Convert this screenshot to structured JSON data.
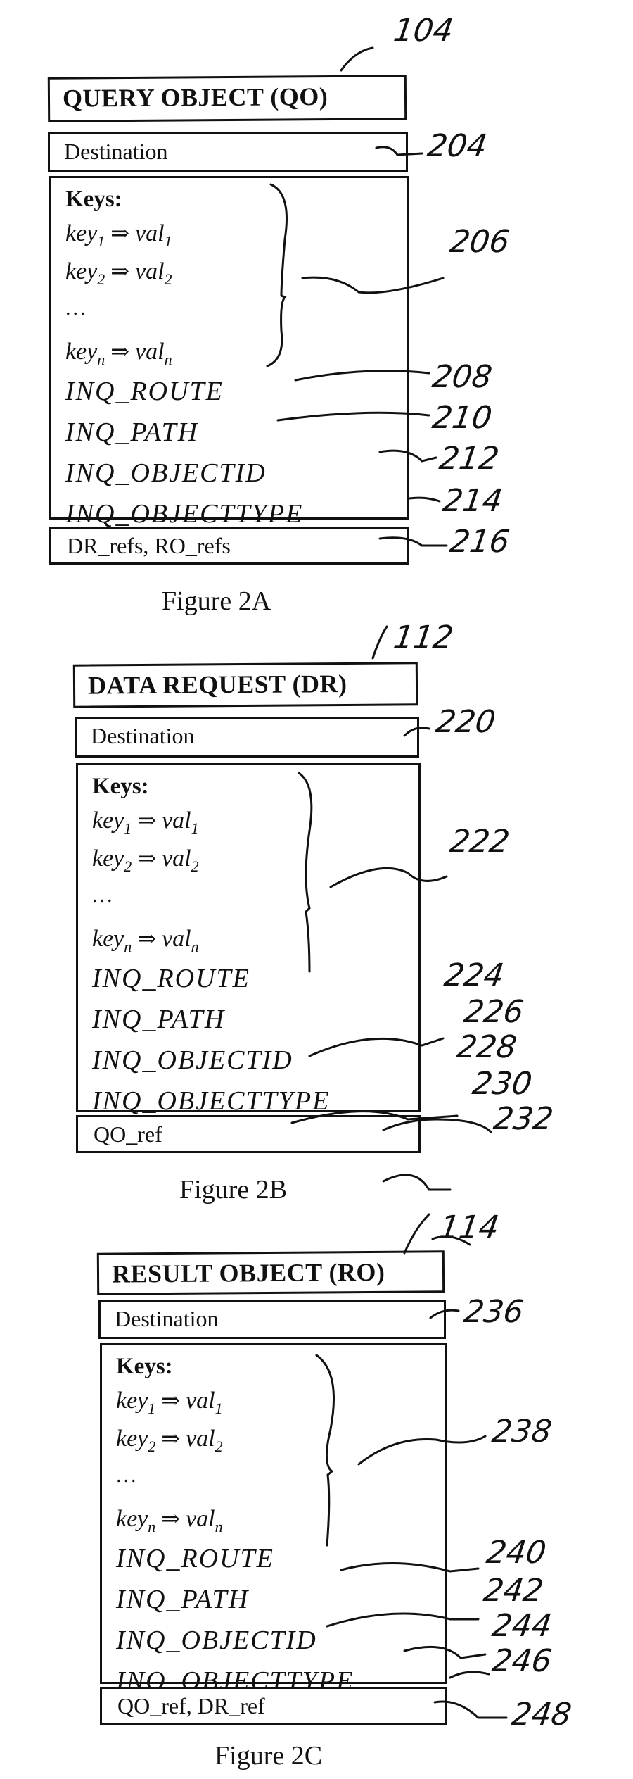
{
  "figures": [
    {
      "caption": "Figure 2A",
      "object_ref": "104",
      "header": "QUERY OBJECT (QO)",
      "destination": {
        "label": "Destination",
        "ref": "204"
      },
      "keys": {
        "label": "Keys:",
        "ref": "206",
        "entries": [
          {
            "key": "key",
            "sub": "1",
            "arrow": "⇒",
            "val": "val",
            "vsub": "1"
          },
          {
            "key": "key",
            "sub": "2",
            "arrow": "⇒",
            "val": "val",
            "vsub": "2"
          },
          {
            "ellipsis": "..."
          },
          {
            "key": "key",
            "sub": "n",
            "arrow": "⇒",
            "val": "val",
            "vsub": "n"
          }
        ]
      },
      "inq_fields": [
        {
          "label": "INQ_ROUTE",
          "ref": "208"
        },
        {
          "label": "INQ_PATH",
          "ref": "210"
        },
        {
          "label": "INQ_OBJECTID",
          "ref": "212"
        },
        {
          "label": "INQ_OBJECTTYPE",
          "ref": "214"
        }
      ],
      "refs": {
        "label": "DR_refs, RO_refs",
        "ref": "216"
      }
    },
    {
      "caption": "Figure 2B",
      "object_ref": "112",
      "header": "DATA REQUEST (DR)",
      "destination": {
        "label": "Destination",
        "ref": "220"
      },
      "keys": {
        "label": "Keys:",
        "ref": "222",
        "entries": [
          {
            "key": "key",
            "sub": "1",
            "arrow": "⇒",
            "val": "val",
            "vsub": "1"
          },
          {
            "key": "key",
            "sub": "2",
            "arrow": "⇒",
            "val": "val",
            "vsub": "2"
          },
          {
            "ellipsis": "..."
          },
          {
            "key": "key",
            "sub": "n",
            "arrow": "⇒",
            "val": "val",
            "vsub": "n"
          }
        ]
      },
      "inq_fields": [
        {
          "label": "INQ_ROUTE",
          "ref": "224"
        },
        {
          "label": "INQ_PATH",
          "ref": "226"
        },
        {
          "label": "INQ_OBJECTID",
          "ref": "228"
        },
        {
          "label": "INQ_OBJECTTYPE",
          "ref": "230"
        }
      ],
      "refs": {
        "label": "QO_ref",
        "ref": "232"
      }
    },
    {
      "caption": "Figure 2C",
      "object_ref": "114",
      "header": "RESULT OBJECT (RO)",
      "destination": {
        "label": "Destination",
        "ref": "236"
      },
      "keys": {
        "label": "Keys:",
        "ref": "238",
        "entries": [
          {
            "key": "key",
            "sub": "1",
            "arrow": "⇒",
            "val": "val",
            "vsub": "1"
          },
          {
            "key": "key",
            "sub": "2",
            "arrow": "⇒",
            "val": "val",
            "vsub": "2"
          },
          {
            "ellipsis": "..."
          },
          {
            "key": "key",
            "sub": "n",
            "arrow": "⇒",
            "val": "val",
            "vsub": "n"
          }
        ]
      },
      "inq_fields": [
        {
          "label": "INQ_ROUTE",
          "ref": "240"
        },
        {
          "label": "INQ_PATH",
          "ref": "242"
        },
        {
          "label": "INQ_OBJECTID",
          "ref": "244"
        },
        {
          "label": "INQ_OBJECTTYPE",
          "ref": "246"
        }
      ],
      "refs": {
        "label": "QO_ref, DR_ref",
        "ref": "248"
      }
    }
  ]
}
